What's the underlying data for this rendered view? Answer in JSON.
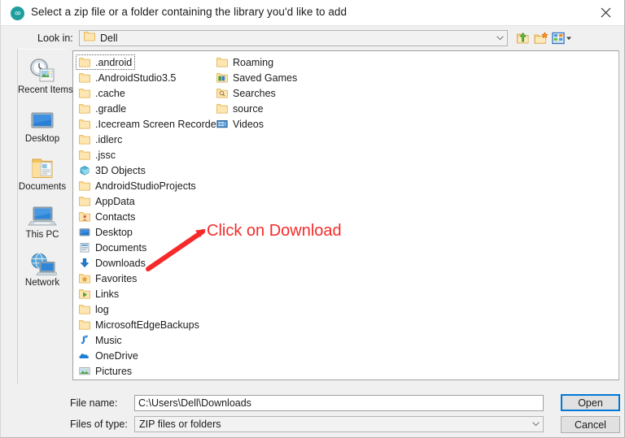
{
  "window": {
    "title": "Select a zip file or a folder containing the library you'd like to add",
    "app_icon": "arduino-logo-icon",
    "close_icon": "close-icon"
  },
  "toolbar": {
    "lookin_label": "Look in:",
    "lookin_value": "Dell",
    "lookin_folder_icon": "folder-icon",
    "dropdown_icon": "chevron-down-icon",
    "buttons": [
      {
        "name": "up-one-level-button",
        "icon": "folder-up-arrow-icon",
        "label": "Up One Level"
      },
      {
        "name": "create-new-folder-button",
        "icon": "folder-new-icon",
        "label": "Create New Folder"
      },
      {
        "name": "view-menu-button",
        "icon": "view-list-icon",
        "label": "View Menu"
      }
    ]
  },
  "places": [
    {
      "label": "Recent Items",
      "icon": "recent-items-icon"
    },
    {
      "label": "Desktop",
      "icon": "desktop-monitor-icon"
    },
    {
      "label": "Documents",
      "icon": "documents-folder-icon"
    },
    {
      "label": "This PC",
      "icon": "this-pc-icon"
    },
    {
      "label": "Network",
      "icon": "network-globe-icon"
    }
  ],
  "files": {
    "column1": [
      {
        "label": ".android",
        "icon": "folder-icon",
        "focused": true
      },
      {
        "label": ".AndroidStudio3.5",
        "icon": "folder-icon"
      },
      {
        "label": ".cache",
        "icon": "folder-icon"
      },
      {
        "label": ".gradle",
        "icon": "folder-icon"
      },
      {
        "label": ".Icecream Screen Recorder",
        "icon": "folder-icon"
      },
      {
        "label": ".idlerc",
        "icon": "folder-icon"
      },
      {
        "label": ".jssc",
        "icon": "folder-icon"
      },
      {
        "label": "3D Objects",
        "icon": "folder-3d-objects-icon"
      },
      {
        "label": "AndroidStudioProjects",
        "icon": "folder-icon"
      },
      {
        "label": "AppData",
        "icon": "folder-icon"
      },
      {
        "label": "Contacts",
        "icon": "folder-contacts-icon"
      },
      {
        "label": "Desktop",
        "icon": "folder-desktop-icon"
      },
      {
        "label": "Documents",
        "icon": "folder-documents-icon"
      },
      {
        "label": "Downloads",
        "icon": "folder-downloads-icon"
      },
      {
        "label": "Favorites",
        "icon": "folder-favorites-icon"
      },
      {
        "label": "Links",
        "icon": "folder-links-icon"
      },
      {
        "label": "log",
        "icon": "folder-icon"
      },
      {
        "label": "MicrosoftEdgeBackups",
        "icon": "folder-icon"
      },
      {
        "label": "Music",
        "icon": "folder-music-icon"
      },
      {
        "label": "OneDrive",
        "icon": "onedrive-cloud-icon"
      },
      {
        "label": "Pictures",
        "icon": "folder-pictures-icon"
      }
    ],
    "column2": [
      {
        "label": "Roaming",
        "icon": "folder-icon"
      },
      {
        "label": "Saved Games",
        "icon": "folder-saved-games-icon"
      },
      {
        "label": "Searches",
        "icon": "folder-searches-icon"
      },
      {
        "label": "source",
        "icon": "folder-icon"
      },
      {
        "label": "Videos",
        "icon": "folder-videos-icon"
      }
    ]
  },
  "fields": {
    "filename_label": "File name:",
    "filename_value": "C:\\Users\\Dell\\Downloads",
    "filetype_label": "Files of type:",
    "filetype_value": "ZIP files or folders"
  },
  "buttons": {
    "open": "Open",
    "cancel": "Cancel"
  },
  "annotation": {
    "text": "Click on Download",
    "color": "#f62a2a",
    "arrow": "arrow-pointing-to-downloads"
  }
}
